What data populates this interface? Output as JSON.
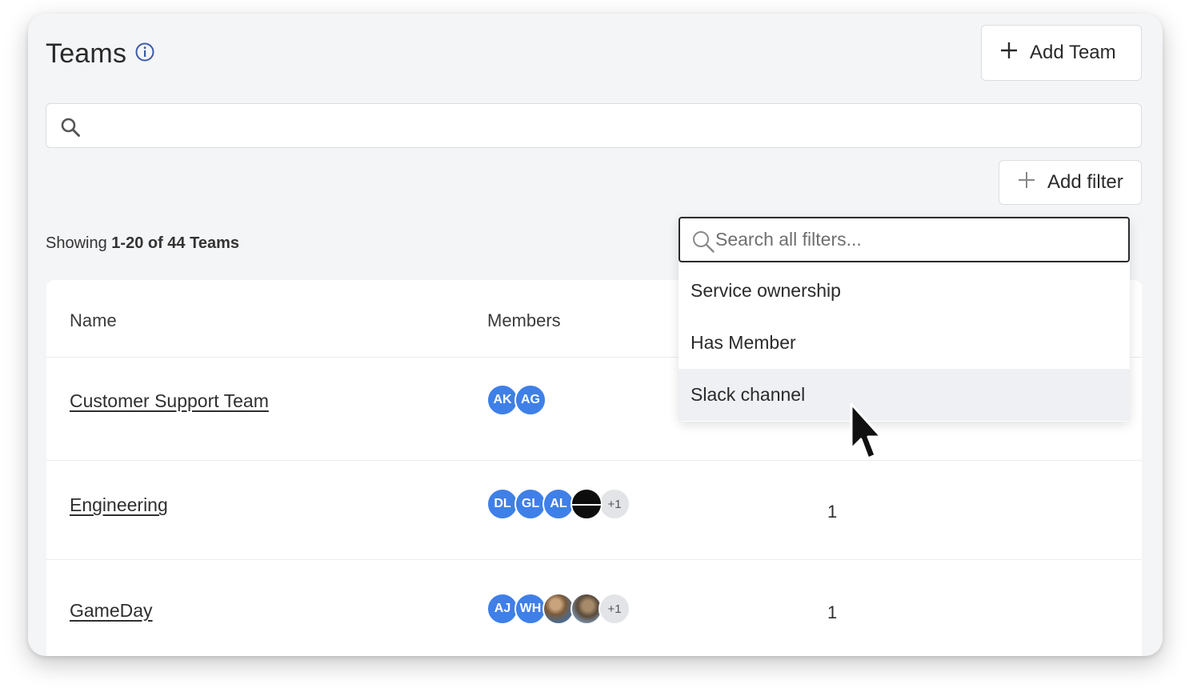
{
  "header": {
    "title": "Teams",
    "info_icon": "info-icon",
    "add_team_label": "Add Team"
  },
  "search": {
    "placeholder": ""
  },
  "filters": {
    "add_filter_label": "Add filter"
  },
  "summary": {
    "prefix": "Showing ",
    "range": "1-20 of 44 Teams"
  },
  "table": {
    "columns": [
      "Name",
      "Members"
    ],
    "rows": [
      {
        "name": "Customer Support Team",
        "members": [
          "AK",
          "AG"
        ],
        "count": ""
      },
      {
        "name": "Engineering",
        "members": [
          "DL",
          "GL",
          "AL"
        ],
        "more": "+1",
        "count": "1"
      },
      {
        "name": "GameDay",
        "members": [
          "AJ",
          "WH"
        ],
        "more": "+1",
        "count": "1"
      }
    ]
  },
  "filter_dropdown": {
    "search_placeholder": "Search all filters...",
    "options": [
      "Service ownership",
      "Has Member",
      "Slack channel"
    ],
    "hovered_index": 2
  },
  "colors": {
    "avatar_blue": "#3f7fe8",
    "page_bg": "#f4f5f7"
  }
}
